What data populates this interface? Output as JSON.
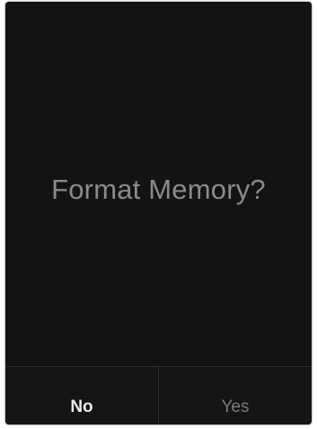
{
  "dialog": {
    "message": "Format Memory?",
    "buttons": {
      "no_label": "No",
      "yes_label": "Yes",
      "selected": "No"
    }
  },
  "colors": {
    "background": "#131313",
    "message_text": "#8a8a8a",
    "selected_text": "#e8e8e8",
    "unselected_text": "#7c7c7c"
  }
}
